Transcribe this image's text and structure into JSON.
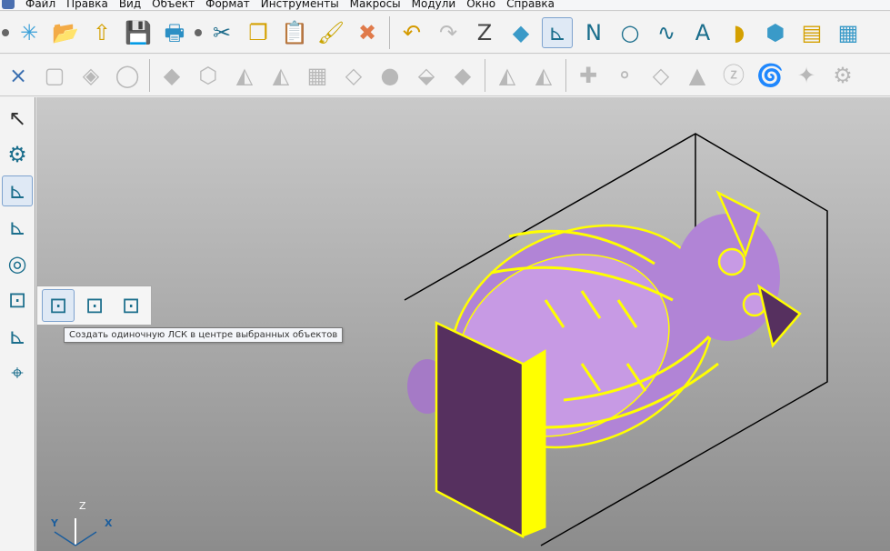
{
  "menu": [
    "Файл",
    "Правка",
    "Вид",
    "Объект",
    "Формат",
    "Инструменты",
    "Макросы",
    "Модули",
    "Окно",
    "Справка"
  ],
  "toolbar1": [
    "new-file",
    "open-file",
    "import",
    "save",
    "print",
    "cut",
    "copy",
    "paste",
    "format-painter",
    "delete",
    "undo",
    "redo",
    "sketch",
    "render",
    "lcs",
    "polyline",
    "circle",
    "spline",
    "text",
    "surface",
    "solid",
    "box-tool",
    "layers"
  ],
  "toolbar2": [
    "close",
    "selection-frame",
    "layers-3d",
    "cylinder",
    "pyramid",
    "extrude",
    "mirror",
    "mirror-copy",
    "mesh",
    "boolean",
    "sphere",
    "section",
    "pyramid-2",
    "pattern",
    "pattern-2",
    "add-primitive",
    "spheres",
    "cut-tool",
    "cone",
    "z-tool",
    "tornado",
    "star",
    "gear"
  ],
  "left_tools": [
    "select-arrow",
    "settings-tool",
    "lcs-tool",
    "lcs-multiple",
    "lcs-rotate",
    "lcs-box",
    "lcs-points",
    "snap-points"
  ],
  "flyout_items": [
    "lcs-center-box",
    "lcs-top-box",
    "lcs-corner-box"
  ],
  "tooltip": "Создать одиночную ЛСК в центре выбранных объектов",
  "axes": {
    "z": "Z",
    "y": "Y",
    "x": "X"
  },
  "colors": {
    "model": "#b184d6",
    "wireframe": "#ffff00",
    "base": "#56305f",
    "bbox": "#000000"
  }
}
